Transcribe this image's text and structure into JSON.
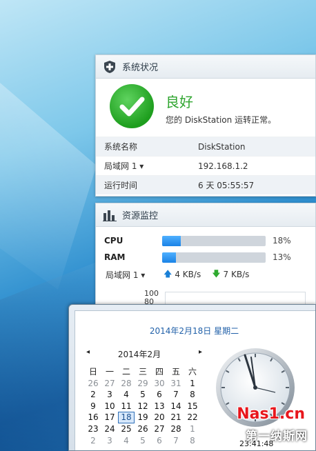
{
  "system_status": {
    "title": "系统状况",
    "status": "良好",
    "description": "您的 DiskStation 运转正常。",
    "rows": [
      {
        "key": "系统名称",
        "value": "DiskStation"
      },
      {
        "key": "局域网 1 ▾",
        "value": "192.168.1.2"
      },
      {
        "key": "运行时间",
        "value": "6 天 05:55:57"
      }
    ]
  },
  "resource_monitor": {
    "title": "资源监控",
    "cpu": {
      "label": "CPU",
      "percent": 18,
      "text": "18%"
    },
    "ram": {
      "label": "RAM",
      "percent": 13,
      "text": "13%"
    },
    "network": {
      "lan": "局域网 1 ▾",
      "upload": "4 KB/s",
      "download": "7 KB/s"
    },
    "chart_ticks": [
      "100",
      "80"
    ]
  },
  "calendar": {
    "date_link": "2014年2月18日 星期二",
    "month_label": "2014年2月",
    "prev_symbol": "◂",
    "next_symbol": "▸",
    "weekdays": [
      "日",
      "一",
      "二",
      "三",
      "四",
      "五",
      "六"
    ],
    "weeks": [
      [
        "26",
        "27",
        "28",
        "29",
        "30",
        "31",
        "1"
      ],
      [
        "2",
        "3",
        "4",
        "5",
        "6",
        "7",
        "8"
      ],
      [
        "9",
        "10",
        "11",
        "12",
        "13",
        "14",
        "15"
      ],
      [
        "16",
        "17",
        "18",
        "19",
        "20",
        "21",
        "22"
      ],
      [
        "23",
        "24",
        "25",
        "26",
        "27",
        "28",
        "1"
      ],
      [
        "2",
        "3",
        "4",
        "5",
        "6",
        "7",
        "8"
      ]
    ],
    "selected_day": "18",
    "clock_time": "23:41:48"
  },
  "watermark": {
    "line1": "Nas1.cn",
    "line2": "第一纳斯网"
  },
  "colors": {
    "accent": "#1a82e6",
    "ok": "#2fa52f",
    "link": "#1f5fa8"
  }
}
